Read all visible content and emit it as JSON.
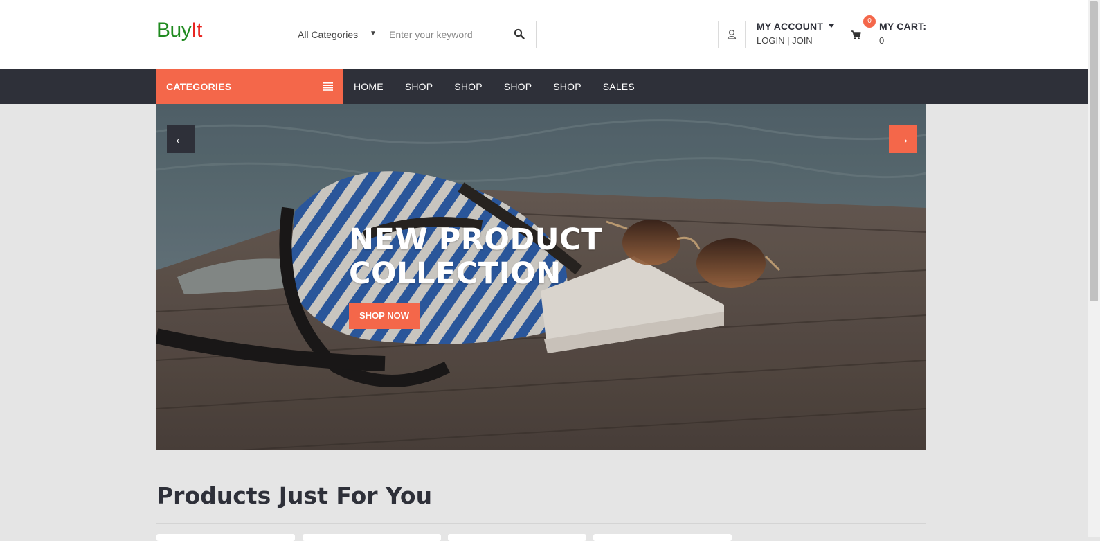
{
  "header": {
    "logo": {
      "part1": "Buy",
      "part2": "It"
    },
    "search": {
      "category": "All Categories",
      "placeholder": "Enter your keyword",
      "icon": "search-icon"
    },
    "account": {
      "title": "MY ACCOUNT",
      "login": "LOGIN",
      "separator": " | ",
      "join": "JOIN",
      "icon": "user-icon"
    },
    "cart": {
      "title": "MY CART:",
      "count": "0",
      "badge": "0",
      "icon": "shopping-cart-icon"
    }
  },
  "nav": {
    "categories_label": "CATEGORIES",
    "categories_icon": "menu-lines-icon",
    "items": [
      {
        "label": "HOME"
      },
      {
        "label": "SHOP"
      },
      {
        "label": "SHOP"
      },
      {
        "label": "SHOP"
      },
      {
        "label": "SHOP"
      },
      {
        "label": "SALES"
      }
    ]
  },
  "hero": {
    "title_line1": "NEW PRODUCT",
    "title_line2": "COLLECTION",
    "button": "SHOP NOW",
    "prev_arrow": "←",
    "next_arrow": "→"
  },
  "products": {
    "title": "Products Just For You"
  },
  "colors": {
    "accent": "#f4674a",
    "nav_dark": "#2e3039",
    "logo_green": "#1f8a1f",
    "logo_red": "#e8231f",
    "page_bg": "#e5e5e5"
  }
}
